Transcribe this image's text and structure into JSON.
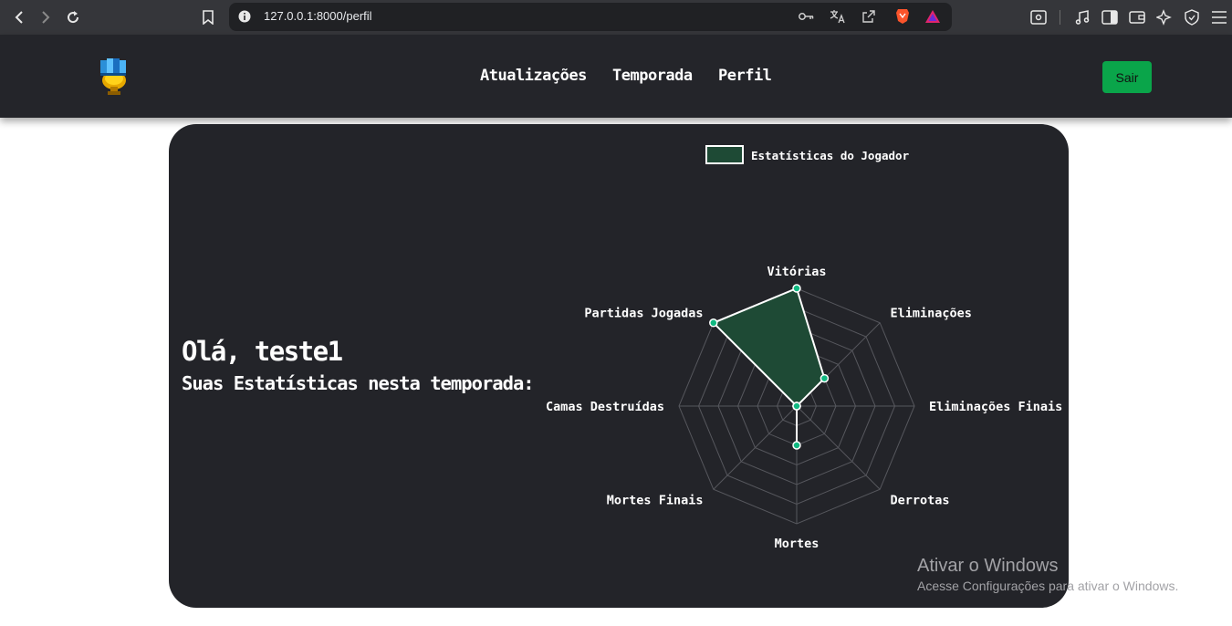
{
  "browser": {
    "url": "127.0.0.1:8000/perfil"
  },
  "header": {
    "nav": [
      {
        "label": "Atualizações"
      },
      {
        "label": "Temporada"
      },
      {
        "label": "Perfil"
      }
    ],
    "logout_label": "Sair"
  },
  "profile": {
    "greeting": "Olá, teste1",
    "subtitle": "Suas Estatísticas nesta temporada:"
  },
  "chart_data": {
    "type": "radar",
    "axes": [
      "Vitórias",
      "Eliminações",
      "Eliminações Finais",
      "Derrotas",
      "Mortes",
      "Mortes Finais",
      "Camas Destruídas",
      "Partidas Jogadas"
    ],
    "series": [
      {
        "name": "Estatísticas do Jogador",
        "values": [
          6,
          2,
          0,
          0,
          2,
          0,
          0,
          6
        ]
      }
    ],
    "rlim": [
      0,
      6
    ],
    "gridlines": 6,
    "legend": "top",
    "fill_color": "#1e4a35",
    "line_color": "#ffffff",
    "point_color": "#10b981"
  },
  "watermark": {
    "title": "Ativar o Windows",
    "subtitle": "Acesse Configurações para ativar o Windows."
  }
}
